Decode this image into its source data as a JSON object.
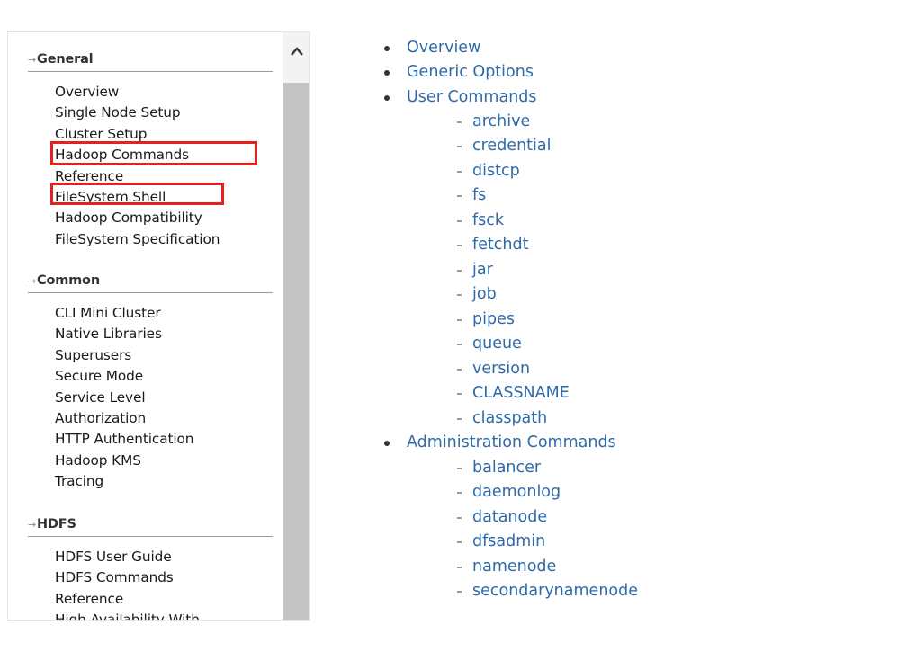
{
  "sidebar": {
    "sections": [
      {
        "title": "General",
        "items": [
          "Overview",
          "Single Node Setup",
          "Cluster Setup",
          "Hadoop Commands",
          "Reference",
          "FileSystem Shell",
          "Hadoop Compatibility",
          "FileSystem Specification"
        ]
      },
      {
        "title": "Common",
        "items": [
          "CLI Mini Cluster",
          "Native Libraries",
          "Superusers",
          "Secure Mode",
          "Service Level",
          "Authorization",
          "HTTP Authentication",
          "Hadoop KMS",
          "Tracing"
        ]
      },
      {
        "title": "HDFS",
        "items": [
          "HDFS User Guide",
          "HDFS Commands",
          "Reference",
          "High Availability With"
        ]
      }
    ],
    "arrow_glyph": "→",
    "scroll_up_icon": "chevron-up-icon"
  },
  "main": {
    "toc": [
      {
        "label": "Overview",
        "children": []
      },
      {
        "label": "Generic Options",
        "children": []
      },
      {
        "label": "User Commands",
        "children": [
          "archive",
          "credential",
          "distcp",
          "fs",
          "fsck",
          "fetchdt",
          "jar",
          "job",
          "pipes",
          "queue",
          "version",
          "CLASSNAME",
          "classpath"
        ]
      },
      {
        "label": "Administration Commands",
        "children": [
          "balancer",
          "daemonlog",
          "datanode",
          "dfsadmin",
          "namenode",
          "secondarynamenode"
        ]
      }
    ]
  },
  "colors": {
    "link": "#2f6aa8",
    "highlight_box": "#e5211b",
    "scroll_thumb": "#c4c4c4"
  }
}
